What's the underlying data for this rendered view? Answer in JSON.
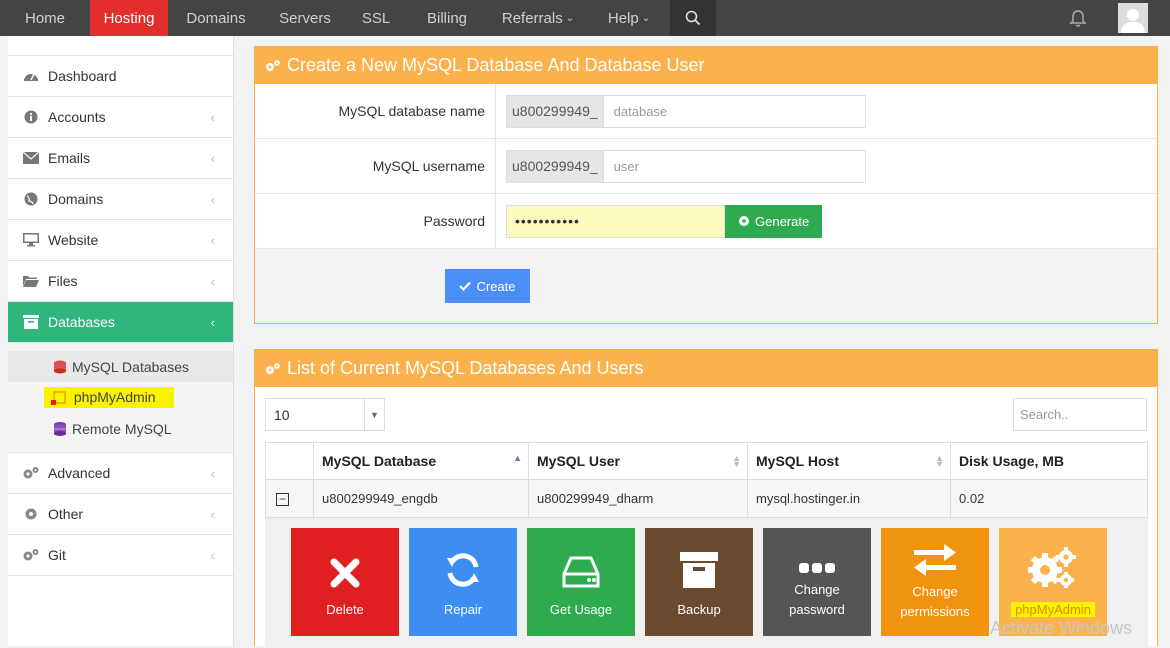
{
  "nav": {
    "items": [
      "Home",
      "Hosting",
      "Domains",
      "Servers",
      "SSL",
      "Billing",
      "Referrals",
      "Help"
    ],
    "active": "Hosting"
  },
  "sidebar": {
    "items": [
      {
        "label": "Dashboard",
        "icon": "dashboard-icon"
      },
      {
        "label": "Accounts",
        "icon": "info-icon"
      },
      {
        "label": "Emails",
        "icon": "envelope-icon"
      },
      {
        "label": "Domains",
        "icon": "globe-icon"
      },
      {
        "label": "Website",
        "icon": "monitor-icon"
      },
      {
        "label": "Files",
        "icon": "folder-icon"
      },
      {
        "label": "Databases",
        "icon": "database-icon"
      }
    ],
    "sub_items": [
      {
        "label": "MySQL Databases",
        "icon": "mysql-icon"
      },
      {
        "label": "phpMyAdmin",
        "icon": "phpmyadmin-icon"
      },
      {
        "label": "Remote MySQL",
        "icon": "remote-db-icon"
      }
    ],
    "bottom_items": [
      {
        "label": "Advanced",
        "icon": "gears-icon"
      },
      {
        "label": "Other",
        "icon": "gear-icon"
      },
      {
        "label": "Git",
        "icon": "gears-icon"
      }
    ]
  },
  "create_panel": {
    "title": "Create a New MySQL Database And Database User",
    "db_name_label": "MySQL database name",
    "db_prefix": "u800299949_",
    "db_placeholder": "database",
    "user_label": "MySQL username",
    "user_prefix": "u800299949_",
    "user_placeholder": "user",
    "password_label": "Password",
    "password_value": "•••••••••••",
    "generate_label": "Generate",
    "create_label": "Create"
  },
  "list_panel": {
    "title": "List of Current MySQL Databases And Users",
    "page_length": "10",
    "search_placeholder": "Search..",
    "columns": [
      "MySQL Database",
      "MySQL User",
      "MySQL Host",
      "Disk Usage, MB"
    ],
    "rows": [
      {
        "database": "u800299949_engdb",
        "user": "u800299949_dharm",
        "host": "mysql.hostinger.in",
        "disk": "0.02"
      }
    ],
    "actions": [
      "Delete",
      "Repair",
      "Get Usage",
      "Backup",
      "Change password",
      "Change permissions",
      "phpMyAdmin"
    ]
  },
  "watermark": "Activate Windows",
  "colors": {
    "nav_bg": "#444444",
    "nav_active": "#e42d2d",
    "sidebar_active": "#2eb67d",
    "panel_header": "#fbb24d",
    "delete": "#e02020",
    "repair": "#3d8ef0",
    "get_usage": "#2eaa4f",
    "backup": "#6b4a30",
    "change_password": "#555555",
    "change_permissions": "#f0940f",
    "phpmyadmin": "#fbb24d",
    "highlight": "#f8f400"
  }
}
